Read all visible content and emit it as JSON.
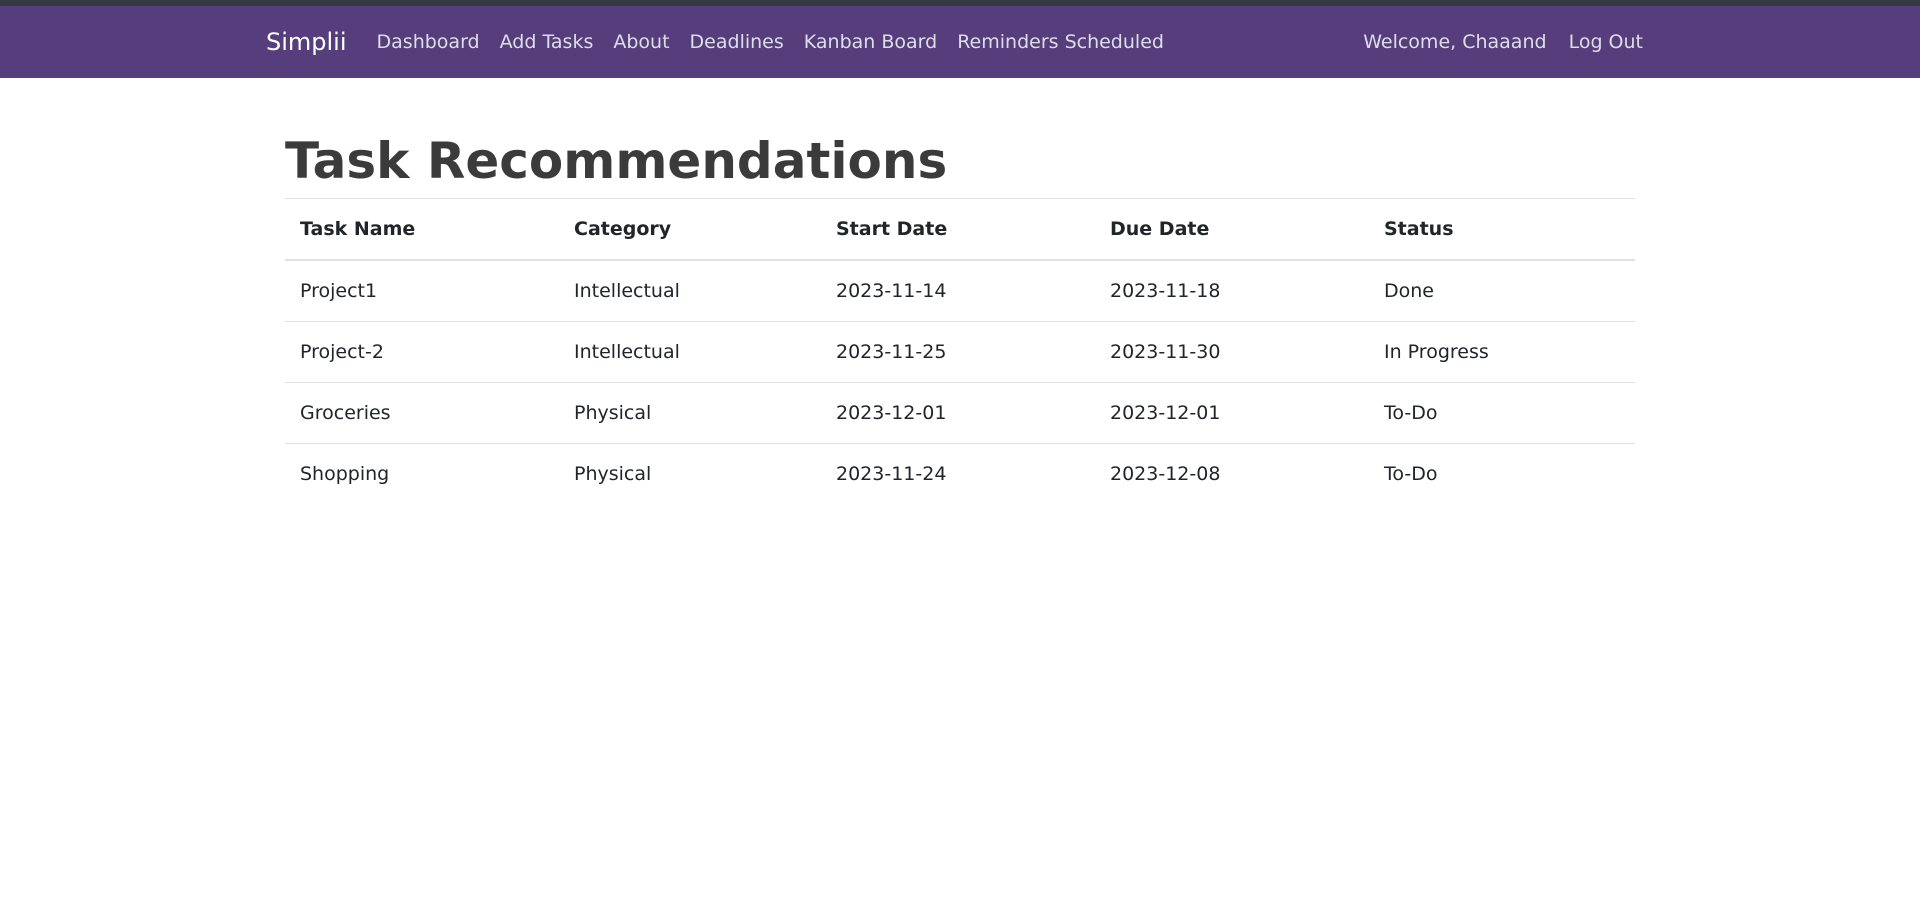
{
  "navbar": {
    "brand": "Simplii",
    "links": [
      {
        "label": "Dashboard"
      },
      {
        "label": "Add Tasks"
      },
      {
        "label": "About"
      },
      {
        "label": "Deadlines"
      },
      {
        "label": "Kanban Board"
      },
      {
        "label": "Reminders Scheduled"
      }
    ],
    "welcome": "Welcome, Chaaand",
    "logout": "Log Out",
    "colors": {
      "navbar_bg": "#563d7c",
      "top_strip": "#343a40"
    }
  },
  "main": {
    "title": "Task Recommendations",
    "table": {
      "headers": [
        "Task Name",
        "Category",
        "Start Date",
        "Due Date",
        "Status"
      ],
      "rows": [
        [
          "Project1",
          "Intellectual",
          "2023-11-14",
          "2023-11-18",
          "Done"
        ],
        [
          "Project-2",
          "Intellectual",
          "2023-11-25",
          "2023-11-30",
          "In Progress"
        ],
        [
          "Groceries",
          "Physical",
          "2023-12-01",
          "2023-12-01",
          "To-Do"
        ],
        [
          "Shopping",
          "Physical",
          "2023-11-24",
          "2023-12-08",
          "To-Do"
        ]
      ]
    }
  }
}
